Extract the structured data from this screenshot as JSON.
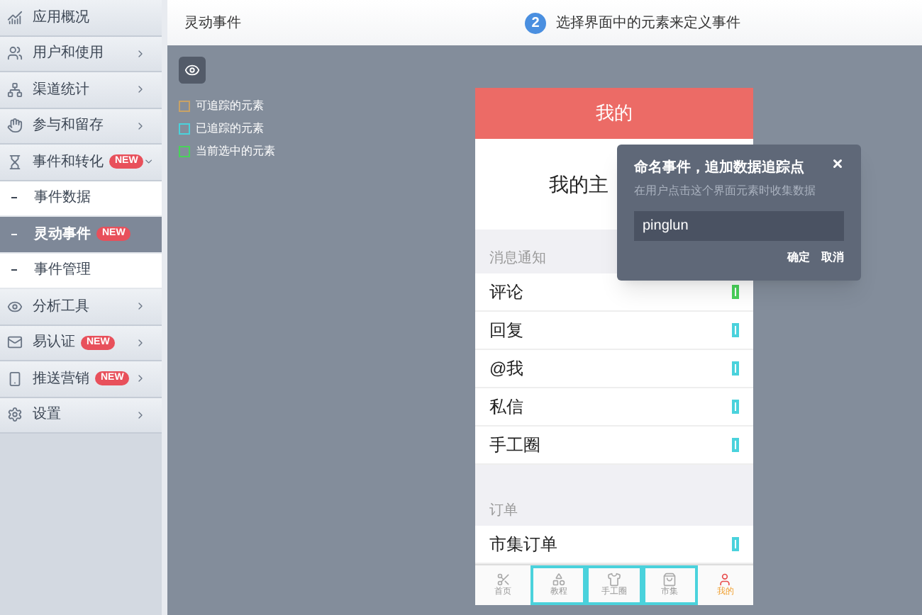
{
  "sidebar": {
    "items": [
      {
        "label": "应用概况",
        "kind": "link"
      },
      {
        "label": "用户和使用",
        "kind": "menu",
        "expanded": false
      },
      {
        "label": "渠道统计",
        "kind": "menu",
        "expanded": false
      },
      {
        "label": "参与和留存",
        "kind": "menu",
        "expanded": false
      },
      {
        "label": "事件和转化",
        "kind": "menu",
        "badge": "NEW",
        "expanded": true,
        "children": [
          {
            "label": "事件数据",
            "selected": false
          },
          {
            "label": "灵动事件",
            "selected": true,
            "badge": "NEW"
          },
          {
            "label": "事件管理",
            "selected": false
          }
        ]
      },
      {
        "label": "分析工具",
        "kind": "menu",
        "expanded": false
      },
      {
        "label": "易认证",
        "kind": "menu",
        "badge": "NEW",
        "expanded": false
      },
      {
        "label": "推送营销",
        "kind": "menu",
        "badge": "NEW",
        "expanded": false
      },
      {
        "label": "设置",
        "kind": "menu",
        "expanded": false
      }
    ]
  },
  "header": {
    "title": "灵动事件",
    "step": "2",
    "step_text": "选择界面中的元素来定义事件"
  },
  "legend": [
    {
      "label": "可追踪的元素",
      "color": "#c8a266"
    },
    {
      "label": "已追踪的元素",
      "color": "#4ad2dc"
    },
    {
      "label": "当前选中的元素",
      "color": "#49d25a"
    }
  ],
  "phone": {
    "title": "我的",
    "profile": "我的主",
    "sections": [
      {
        "label": "消息通知",
        "rows": [
          {
            "label": "评论",
            "color": "#49d25a"
          },
          {
            "label": "回复",
            "color": "#4ad2dc"
          },
          {
            "label": "@我",
            "color": "#4ad2dc"
          },
          {
            "label": "私信",
            "color": "#4ad2dc"
          },
          {
            "label": "手工圈",
            "color": "#4ad2dc"
          }
        ]
      },
      {
        "label": "订单",
        "rows": [
          {
            "label": "市集订单",
            "color": "#4ad2dc"
          }
        ]
      }
    ],
    "tabs": [
      {
        "label": "首页",
        "selected": false,
        "tracked": false
      },
      {
        "label": "教程",
        "selected": false,
        "tracked": true
      },
      {
        "label": "手工圈",
        "selected": false,
        "tracked": true
      },
      {
        "label": "市集",
        "selected": false,
        "tracked": true
      },
      {
        "label": "我的",
        "selected": true,
        "tracked": false
      }
    ]
  },
  "dialog": {
    "title": "命名事件，追加数据追踪点",
    "hint": "在用户点击这个界面元素时收集数据",
    "value": "pinglun",
    "buttons": [
      "确定",
      "取消"
    ]
  }
}
